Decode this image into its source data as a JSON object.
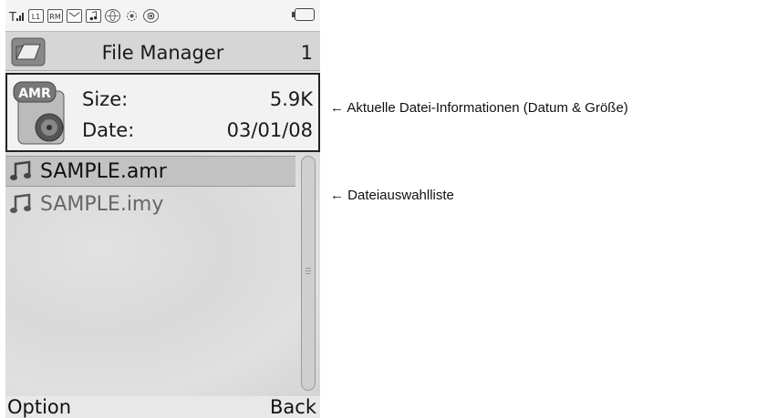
{
  "status_bar": {
    "icons": [
      "signal-icon",
      "line1-icon",
      "rm-icon",
      "message-icon",
      "music-icon",
      "globe-icon",
      "settings-icon",
      "disc-icon",
      "battery-icon"
    ],
    "line_label": "L1",
    "rm_label": "RM"
  },
  "titlebar": {
    "title": "File Manager",
    "count": "1"
  },
  "info": {
    "badge": "AMR",
    "size_label": "Size:",
    "size_value": "5.9K",
    "date_label": "Date:",
    "date_value": "03/01/08"
  },
  "files": [
    {
      "name": "SAMPLE.amr",
      "selected": true
    },
    {
      "name": "SAMPLE.imy",
      "selected": false
    }
  ],
  "softkeys": {
    "left": "Option",
    "right": "Back"
  },
  "annotations": {
    "info": "← Aktuelle Datei-Informationen (Datum & Größe)",
    "list": "← Dateiauswahlliste"
  }
}
